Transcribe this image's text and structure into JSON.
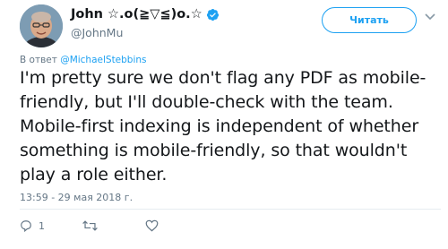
{
  "author": {
    "display_name": "John ☆.o(≧▽≦)o.☆",
    "handle": "@JohnMu",
    "verified": true,
    "avatar_icon": "avatar-photo"
  },
  "follow_button": {
    "label": "Читать"
  },
  "reply": {
    "prefix": "В ответ ",
    "mention": "@MichaelStebbins"
  },
  "tweet": {
    "text": "I'm pretty sure we don't flag any PDF as mobile-friendly, but I'll double-check with the team. Mobile-first indexing is independent of whether something is mobile-friendly, so that wouldn't play a role either.",
    "timestamp": "13:59 - 29 мая 2018 г."
  },
  "actions": {
    "reply_count": "1",
    "retweet_count": "",
    "like_count": ""
  },
  "colors": {
    "accent": "#1da1f2",
    "text": "#14171a",
    "muted": "#657786"
  }
}
